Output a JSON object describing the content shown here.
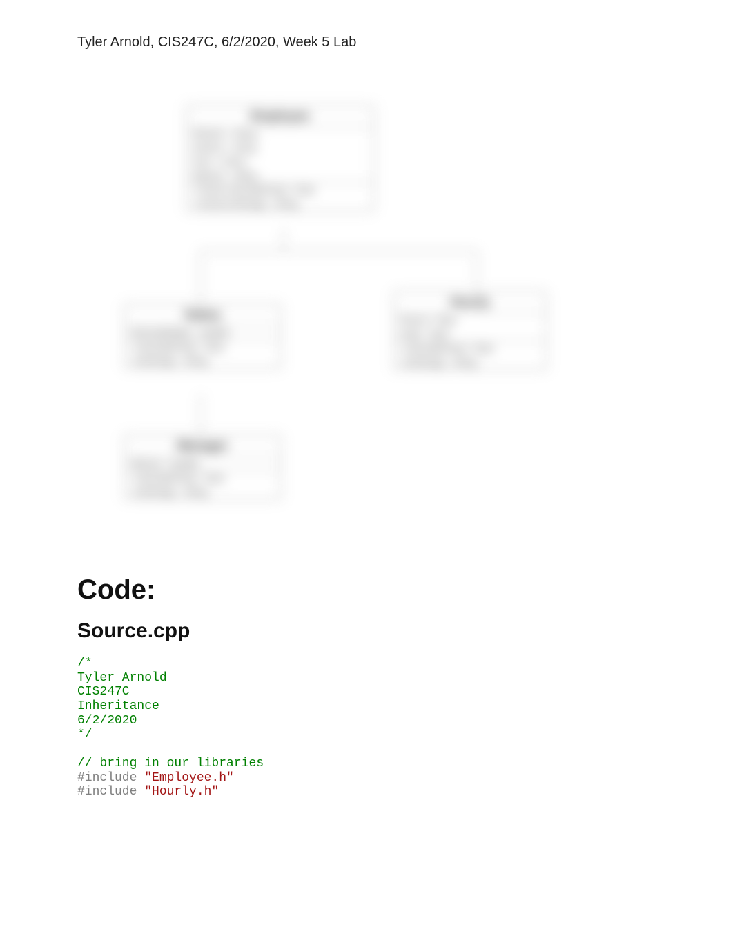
{
  "header": "Tyler Arnold, CIS247C, 6/2/2020, Week 5 Lab",
  "diagram": {
    "employee": {
      "title": "Employee",
      "attrs": [
        "#fname : string",
        "#lname : string",
        "#ssn : string",
        "#phone : string"
      ],
      "ops": [
        "+virtual calculatePay() : float",
        "+virtual toString() : string"
      ]
    },
    "salary": {
      "title": "Salary",
      "attrs": [
        "#annualSalary : double"
      ],
      "ops": [
        "+calculatePay() : float",
        "+toString() : string"
      ]
    },
    "hourly": {
      "title": "Hourly",
      "attrs": [
        "#hours : float",
        "#rate : float"
      ],
      "ops": [
        "+calculatePay() : float",
        "+toString() : string"
      ]
    },
    "manager": {
      "title": "Manager",
      "attrs": [
        "#bonus : double"
      ],
      "ops": [
        "+calculatePay() : float",
        "+toString() : string"
      ]
    }
  },
  "headings": {
    "code": "Code:",
    "source": "Source.cpp"
  },
  "code": {
    "comment_block": "/*\nTyler Arnold\nCIS247C\nInheritance\n6/2/2020\n*/",
    "comment_libs": "// bring in our libraries",
    "include_kw1": "#include ",
    "include_str1": "\"Employee.h\"",
    "include_kw2": "#include ",
    "include_str2": "\"Hourly.h\""
  }
}
